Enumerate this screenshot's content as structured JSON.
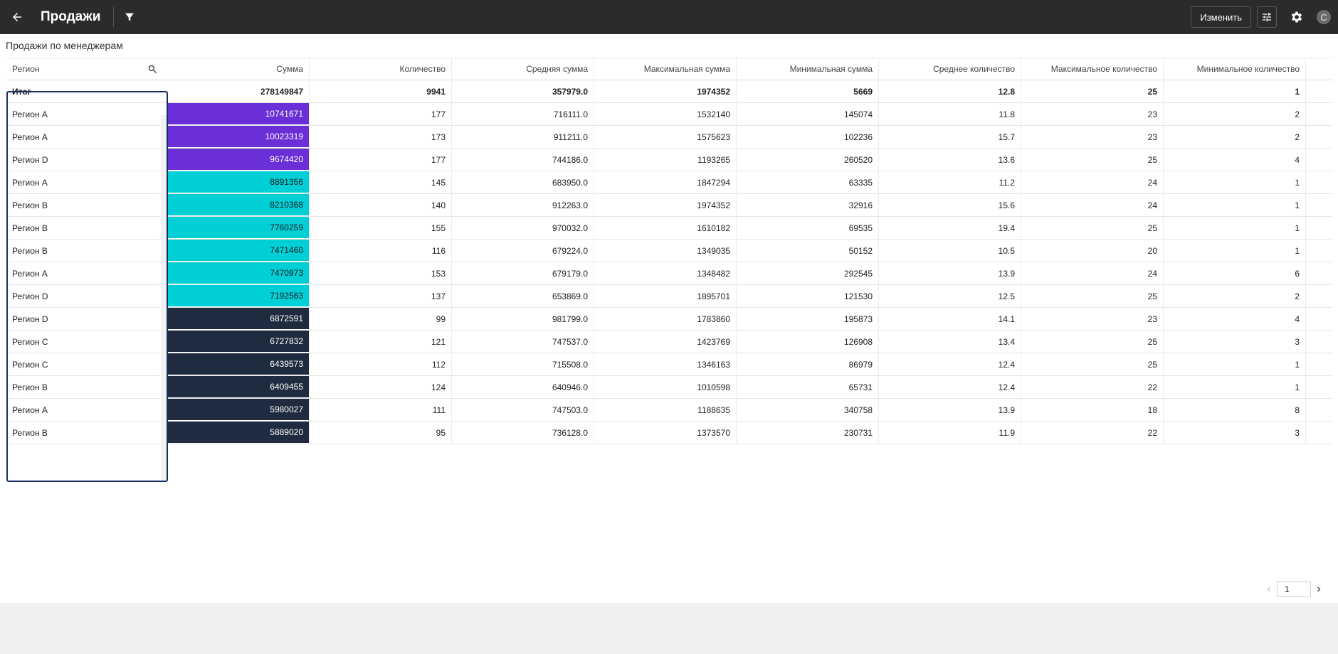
{
  "app": {
    "title": "Продажи",
    "edit_label": "Изменить",
    "avatar_letter": "C"
  },
  "widget": {
    "title": "Продажи по менеджерам"
  },
  "columns": [
    "Регион",
    "Сумма",
    "Количество",
    "Средняя сумма",
    "Максимальная сумма",
    "Минимальная сумма",
    "Среднее количество",
    "Максимальное количество",
    "Минимальное количество"
  ],
  "total": [
    "Итог",
    "278149847",
    "9941",
    "357979.0",
    "1974352",
    "5669",
    "12.8",
    "25",
    "1"
  ],
  "rows": [
    [
      "Регион A",
      "10741671",
      "177",
      "716111.0",
      "1532140",
      "145074",
      "11.8",
      "23",
      "2"
    ],
    [
      "Регион A",
      "10023319",
      "173",
      "911211.0",
      "1575623",
      "102236",
      "15.7",
      "23",
      "2"
    ],
    [
      "Регион D",
      "9674420",
      "177",
      "744186.0",
      "1193265",
      "260520",
      "13.6",
      "25",
      "4"
    ],
    [
      "Регион A",
      "8891356",
      "145",
      "683950.0",
      "1847294",
      "63335",
      "11.2",
      "24",
      "1"
    ],
    [
      "Регион B",
      "8210368",
      "140",
      "912263.0",
      "1974352",
      "32916",
      "15.6",
      "24",
      "1"
    ],
    [
      "Регион B",
      "7760259",
      "155",
      "970032.0",
      "1610182",
      "69535",
      "19.4",
      "25",
      "1"
    ],
    [
      "Регион B",
      "7471460",
      "116",
      "679224.0",
      "1349035",
      "50152",
      "10.5",
      "20",
      "1"
    ],
    [
      "Регион A",
      "7470973",
      "153",
      "679179.0",
      "1348482",
      "292545",
      "13.9",
      "24",
      "6"
    ],
    [
      "Регион D",
      "7192563",
      "137",
      "653869.0",
      "1895701",
      "121530",
      "12.5",
      "25",
      "2"
    ],
    [
      "Регион D",
      "6872591",
      "99",
      "981799.0",
      "1783860",
      "195873",
      "14.1",
      "23",
      "4"
    ],
    [
      "Регион C",
      "6727832",
      "121",
      "747537.0",
      "1423769",
      "126908",
      "13.4",
      "25",
      "3"
    ],
    [
      "Регион C",
      "6439573",
      "112",
      "715508.0",
      "1346163",
      "86979",
      "12.4",
      "25",
      "1"
    ],
    [
      "Регион B",
      "6409455",
      "124",
      "640946.0",
      "1010598",
      "65731",
      "12.4",
      "22",
      "1"
    ],
    [
      "Регион A",
      "5980027",
      "111",
      "747503.0",
      "1188635",
      "340758",
      "13.9",
      "18",
      "8"
    ],
    [
      "Регион B",
      "5889020",
      "95",
      "736128.0",
      "1373570",
      "230731",
      "11.9",
      "22",
      "3"
    ]
  ],
  "sum_colors": [
    "#6a2fd6",
    "#6a2fd6",
    "#6a2fd6",
    "#00d0d6",
    "#00d0d6",
    "#00d0d6",
    "#00d0d6",
    "#00d0d6",
    "#00d0d6",
    "#1f2c3f",
    "#1f2c3f",
    "#1f2c3f",
    "#1f2c3f",
    "#1f2c3f",
    "#1f2c3f"
  ],
  "sum_text_colors": [
    "#ffffff",
    "#ffffff",
    "#ffffff",
    "#1a1a1a",
    "#1a1a1a",
    "#1a1a1a",
    "#1a1a1a",
    "#1a1a1a",
    "#1a1a1a",
    "#ffffff",
    "#ffffff",
    "#ffffff",
    "#ffffff",
    "#ffffff",
    "#ffffff"
  ],
  "pager": {
    "current_page": "1"
  }
}
